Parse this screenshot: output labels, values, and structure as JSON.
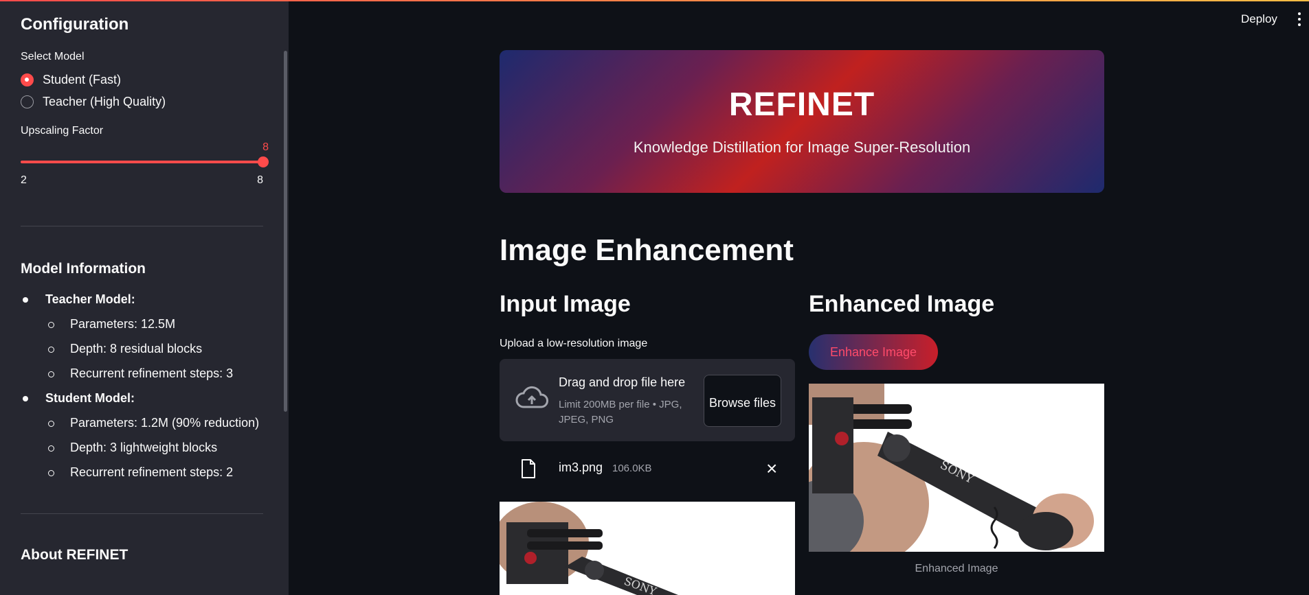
{
  "header": {
    "deploy_label": "Deploy"
  },
  "sidebar": {
    "title": "Configuration",
    "model_select": {
      "label": "Select Model",
      "options": [
        "Student (Fast)",
        "Teacher (High Quality)"
      ],
      "selected": "Student (Fast)"
    },
    "upscale": {
      "label": "Upscaling Factor",
      "value": "8",
      "min": "2",
      "max": "8"
    },
    "model_info": {
      "title": "Model Information",
      "teacher": {
        "label": "Teacher Model:",
        "items": [
          "Parameters: 12.5M",
          "Depth: 8 residual blocks",
          "Recurrent refinement steps: 3"
        ]
      },
      "student": {
        "label": "Student Model:",
        "items": [
          "Parameters: 1.2M (90% reduction)",
          "Depth: 3 lightweight blocks",
          "Recurrent refinement steps: 2"
        ]
      }
    },
    "about_title": "About REFINET"
  },
  "hero": {
    "title": "REFINET",
    "subtitle": "Knowledge Distillation for Image Super-Resolution"
  },
  "main": {
    "title": "Image Enhancement",
    "input": {
      "heading": "Input Image",
      "upload_label": "Upload a low-resolution image",
      "drop_title": "Drag and drop file here",
      "drop_limit": "Limit 200MB per file • JPG, JPEG, PNG",
      "browse_label": "Browse files",
      "file_name": "im3.png",
      "file_size": "106.0KB"
    },
    "output": {
      "heading": "Enhanced Image",
      "enhance_label": "Enhance Image",
      "caption": "Enhanced Image"
    }
  },
  "colors": {
    "accent": "#ff4b4b",
    "background": "#0e1117",
    "sidebar": "#262730"
  },
  "icons": [
    "cloud-upload-icon",
    "file-icon",
    "close-icon",
    "kebab-menu-icon"
  ]
}
